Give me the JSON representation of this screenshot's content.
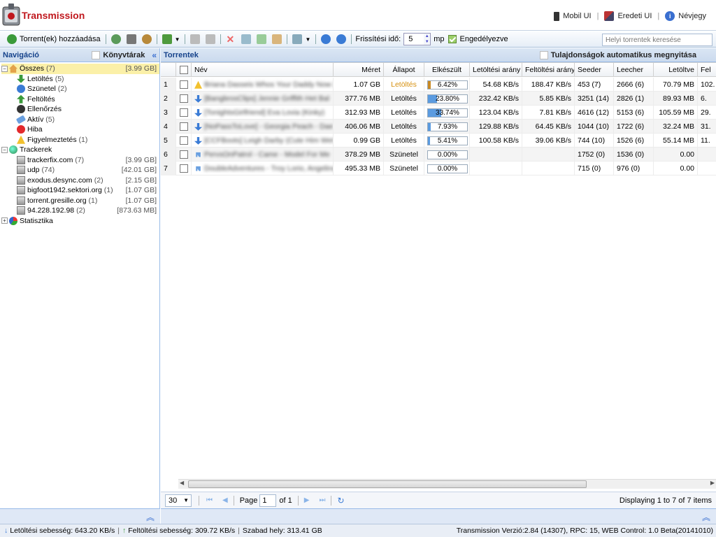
{
  "app": {
    "title": "Transmission"
  },
  "header_links": {
    "mobile": "Mobil UI",
    "original": "Eredeti UI",
    "about": "Névjegy"
  },
  "toolbar": {
    "add_torrent": "Torrent(ek) hozzáadása",
    "refresh_label": "Frissítési idő:",
    "refresh_value": "5",
    "refresh_unit": "mp",
    "enabled_label": "Engedélyezve",
    "search_placeholder": "Helyi torrentek keresése"
  },
  "nav": {
    "title": "Navigáció",
    "libraries_label": "Könyvtárak",
    "all": {
      "label": "Összes",
      "count": "(7)",
      "size": "[3.99 GB]"
    },
    "status_items": [
      {
        "label": "Letöltés",
        "count": "(5)"
      },
      {
        "label": "Szünetel",
        "count": "(2)"
      },
      {
        "label": "Feltöltés",
        "count": ""
      },
      {
        "label": "Ellenőrzés",
        "count": ""
      },
      {
        "label": "Aktív",
        "count": "(5)"
      },
      {
        "label": "Hiba",
        "count": ""
      },
      {
        "label": "Figyelmeztetés",
        "count": "(1)"
      }
    ],
    "trackers_label": "Trackerek",
    "trackers": [
      {
        "label": "trackerfix.com",
        "count": "(7)",
        "size": "[3.99 GB]"
      },
      {
        "label": "udp",
        "count": "(74)",
        "size": "[42.01 GB]"
      },
      {
        "label": "exodus.desync.com",
        "count": "(2)",
        "size": "[2.15 GB]"
      },
      {
        "label": "bigfoot1942.sektori.org",
        "count": "(1)",
        "size": "[1.07 GB]"
      },
      {
        "label": "torrent.gresille.org",
        "count": "(1)",
        "size": "[1.07 GB]"
      },
      {
        "label": "94.228.192.98",
        "count": "(2)",
        "size": "[873.63 MB]"
      }
    ],
    "stats_label": "Statisztika"
  },
  "main": {
    "title": "Torrentek",
    "auto_open_label": "Tulajdonságok automatikus megnyitása",
    "columns": [
      "Név",
      "Méret",
      "Állapot",
      "Elkészült",
      "Letöltési arány",
      "Feltöltési arány",
      "Seeder",
      "Leecher",
      "Letöltve",
      "Fel"
    ],
    "rows": [
      {
        "num": "1",
        "name": "Briana Dasseis Whos Your Daddy Now 2",
        "icon": "warning",
        "size": "1.07 GB",
        "status": "Letöltés",
        "status_color": "#d6900f",
        "done": "6.42%",
        "done_value": 6.42,
        "bar_color": "#c98a24",
        "dl": "54.68 KB/s",
        "ul": "188.47 KB/s",
        "seed": "453 (7)",
        "leech": "2666 (6)",
        "downloaded": "70.79 MB",
        "up": "102."
      },
      {
        "num": "2",
        "name": "[BangbrosClips] Jennie Griffith Het Bal",
        "icon": "down",
        "size": "377.76 MB",
        "status": "Letöltés",
        "status_color": "#000000",
        "done": "23.80%",
        "done_value": 23.8,
        "bar_color": "#5b9be0",
        "dl": "232.42 KB/s",
        "ul": "5.85 KB/s",
        "seed": "3251 (14)",
        "leech": "2826 (1)",
        "downloaded": "89.93 MB",
        "up": "6."
      },
      {
        "num": "3",
        "name": "[TonightsGirlfriend] Eva Lovia (Kinky)",
        "icon": "down",
        "size": "312.93 MB",
        "status": "Letöltés",
        "status_color": "#000000",
        "done": "33.74%",
        "done_value": 33.74,
        "bar_color": "#5b9be0",
        "dl": "123.04 KB/s",
        "ul": "7.81 KB/s",
        "seed": "4616 (12)",
        "leech": "5153 (6)",
        "downloaded": "105.59 MB",
        "up": "29."
      },
      {
        "num": "4",
        "name": "[NoPassToLove] - Georgia Peach - Dae",
        "icon": "down",
        "size": "406.06 MB",
        "status": "Letöltés",
        "status_color": "#000000",
        "done": "7.93%",
        "done_value": 7.93,
        "bar_color": "#5b9be0",
        "dl": "129.88 KB/s",
        "ul": "64.45 KB/s",
        "seed": "1044 (10)",
        "leech": "1722 (6)",
        "downloaded": "32.24 MB",
        "up": "31."
      },
      {
        "num": "5",
        "name": "[CCFBoots] Leigh Darby (Cute Him Wet",
        "icon": "down",
        "size": "0.99 GB",
        "status": "Letöltés",
        "status_color": "#000000",
        "done": "5.41%",
        "done_value": 5.41,
        "bar_color": "#5b9be0",
        "dl": "100.58 KB/s",
        "ul": "39.06 KB/s",
        "seed": "744 (10)",
        "leech": "1526 (6)",
        "downloaded": "55.14 MB",
        "up": "11."
      },
      {
        "num": "6",
        "name": "PervsOnPatrol - Came - Model For Me",
        "icon": "pause",
        "size": "378.29 MB",
        "status": "Szünetel",
        "status_color": "#000000",
        "done": "0.00%",
        "done_value": 0,
        "bar_color": "#5b9be0",
        "dl": "",
        "ul": "",
        "seed": "1752 (0)",
        "leech": "1536 (0)",
        "downloaded": "0.00",
        "up": ""
      },
      {
        "num": "7",
        "name": "DoubleAdventures - Troy Lorio, Angelina",
        "icon": "pause",
        "size": "495.33 MB",
        "status": "Szünetel",
        "status_color": "#000000",
        "done": "0.00%",
        "done_value": 0,
        "bar_color": "#5b9be0",
        "dl": "",
        "ul": "",
        "seed": "715 (0)",
        "leech": "976 (0)",
        "downloaded": "0.00",
        "up": ""
      }
    ]
  },
  "pager": {
    "page_size": "30",
    "page_label": "Page",
    "page_value": "1",
    "of_label": "of 1",
    "displaying": "Displaying 1 to 7 of 7 items"
  },
  "status_bar": {
    "download_speed": "Letöltési sebesség: 643.20 KB/s",
    "upload_speed": "Feltöltési sebesség: 309.72 KB/s",
    "free_space": "Szabad hely: 313.41 GB",
    "version": "Transmission Verzió:2.84 (14307), RPC: 15, WEB Control: 1.0 Beta(20141010)"
  },
  "colors": {
    "accent": "#15428b",
    "brand": "#c0181e",
    "selection": "#fbf0a8",
    "progress": "#5b9be0"
  }
}
